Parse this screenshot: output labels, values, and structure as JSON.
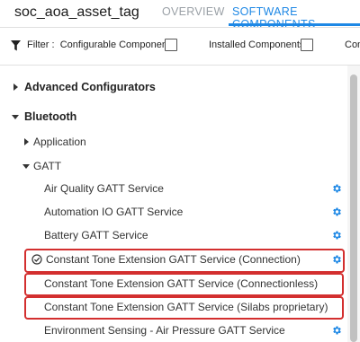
{
  "header": {
    "app_title": "soc_aoa_asset_tag",
    "tabs": [
      {
        "label": "OVERVIEW",
        "active": false
      },
      {
        "label": "SOFTWARE COMPONENTS",
        "active": true
      }
    ]
  },
  "filter": {
    "label": "Filter :",
    "configurable_label": "Configurable Components",
    "configurable_checked": false,
    "installed_label": "Installed Components",
    "installed_checked": false,
    "overflow_label": "Con"
  },
  "tree": {
    "advanced": {
      "label": "Advanced Configurators",
      "expanded": false
    },
    "bluetooth": {
      "label": "Bluetooth",
      "expanded": true
    },
    "application": {
      "label": "Application",
      "expanded": false
    },
    "gatt": {
      "label": "GATT",
      "expanded": true
    },
    "items": [
      {
        "label": "Air Quality GATT Service",
        "configurable": true,
        "installed": false
      },
      {
        "label": "Automation IO GATT Service",
        "configurable": true,
        "installed": false
      },
      {
        "label": "Battery GATT Service",
        "configurable": true,
        "installed": false
      },
      {
        "label": "Constant Tone Extension GATT Service (Connection)",
        "configurable": true,
        "installed": true,
        "highlighted": true
      },
      {
        "label": "Constant Tone Extension GATT Service (Connectionless)",
        "configurable": false,
        "installed": false,
        "highlighted": true
      },
      {
        "label": "Constant Tone Extension GATT Service (Silabs proprietary)",
        "configurable": false,
        "installed": false,
        "highlighted": true
      },
      {
        "label": "Environment Sensing - Air Pressure GATT Service",
        "configurable": true,
        "installed": false
      }
    ]
  },
  "colors": {
    "accent": "#1e88e5",
    "highlight": "#d32f2f",
    "gear": "#1e88e5"
  },
  "icons": {
    "filter": "filter-icon",
    "gear": "gear-icon",
    "installed": "check-circle-icon",
    "collapsed": "caret-right-icon",
    "expanded": "caret-down-icon"
  }
}
